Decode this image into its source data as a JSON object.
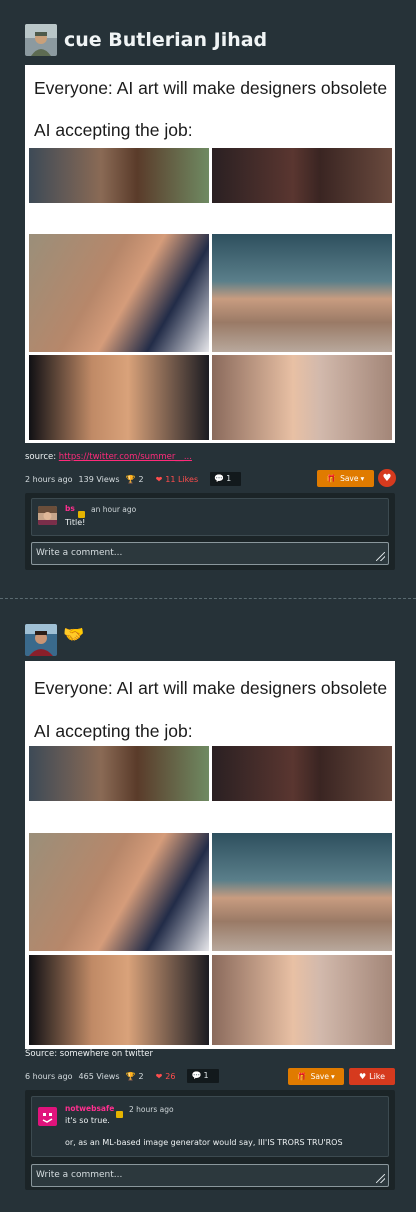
{
  "posts": [
    {
      "title": "cue Butlerian Jihad",
      "meme_line1": "Everyone: AI art will make designers obsolete",
      "meme_line2": "AI accepting the job:",
      "source_label": "source:",
      "source_link": "https://twitter.com/summer__...",
      "time": "2 hours ago",
      "views": "139 Views",
      "awards": "2",
      "likes": "11 Likes",
      "comments": "1",
      "save_label": "Save",
      "comment": {
        "author": "bs",
        "time": "an hour ago",
        "text": "Title!"
      },
      "comment_placeholder": "Write a comment..."
    },
    {
      "title_emoji": "🤝",
      "meme_line1": "Everyone: AI art will make designers obsolete",
      "meme_line2": "AI accepting the job:",
      "source_text": "Source: somewhere on twitter",
      "time": "6 hours ago",
      "views": "465 Views",
      "awards": "2",
      "likes": "26",
      "comments": "1",
      "save_label": "Save",
      "like_label": "Like",
      "comment": {
        "author": "notwebsafe",
        "time": "2 hours ago",
        "text1": "it's so true.",
        "text2": "or, as an ML-based image generator would say, III'IS TRORS TRU'ROS"
      },
      "comment_placeholder": "Write a comment..."
    }
  ],
  "colors": {
    "background": "#263238",
    "accent_link": "#ff2b7a",
    "save": "#e07b00",
    "like": "#d63a1e"
  }
}
